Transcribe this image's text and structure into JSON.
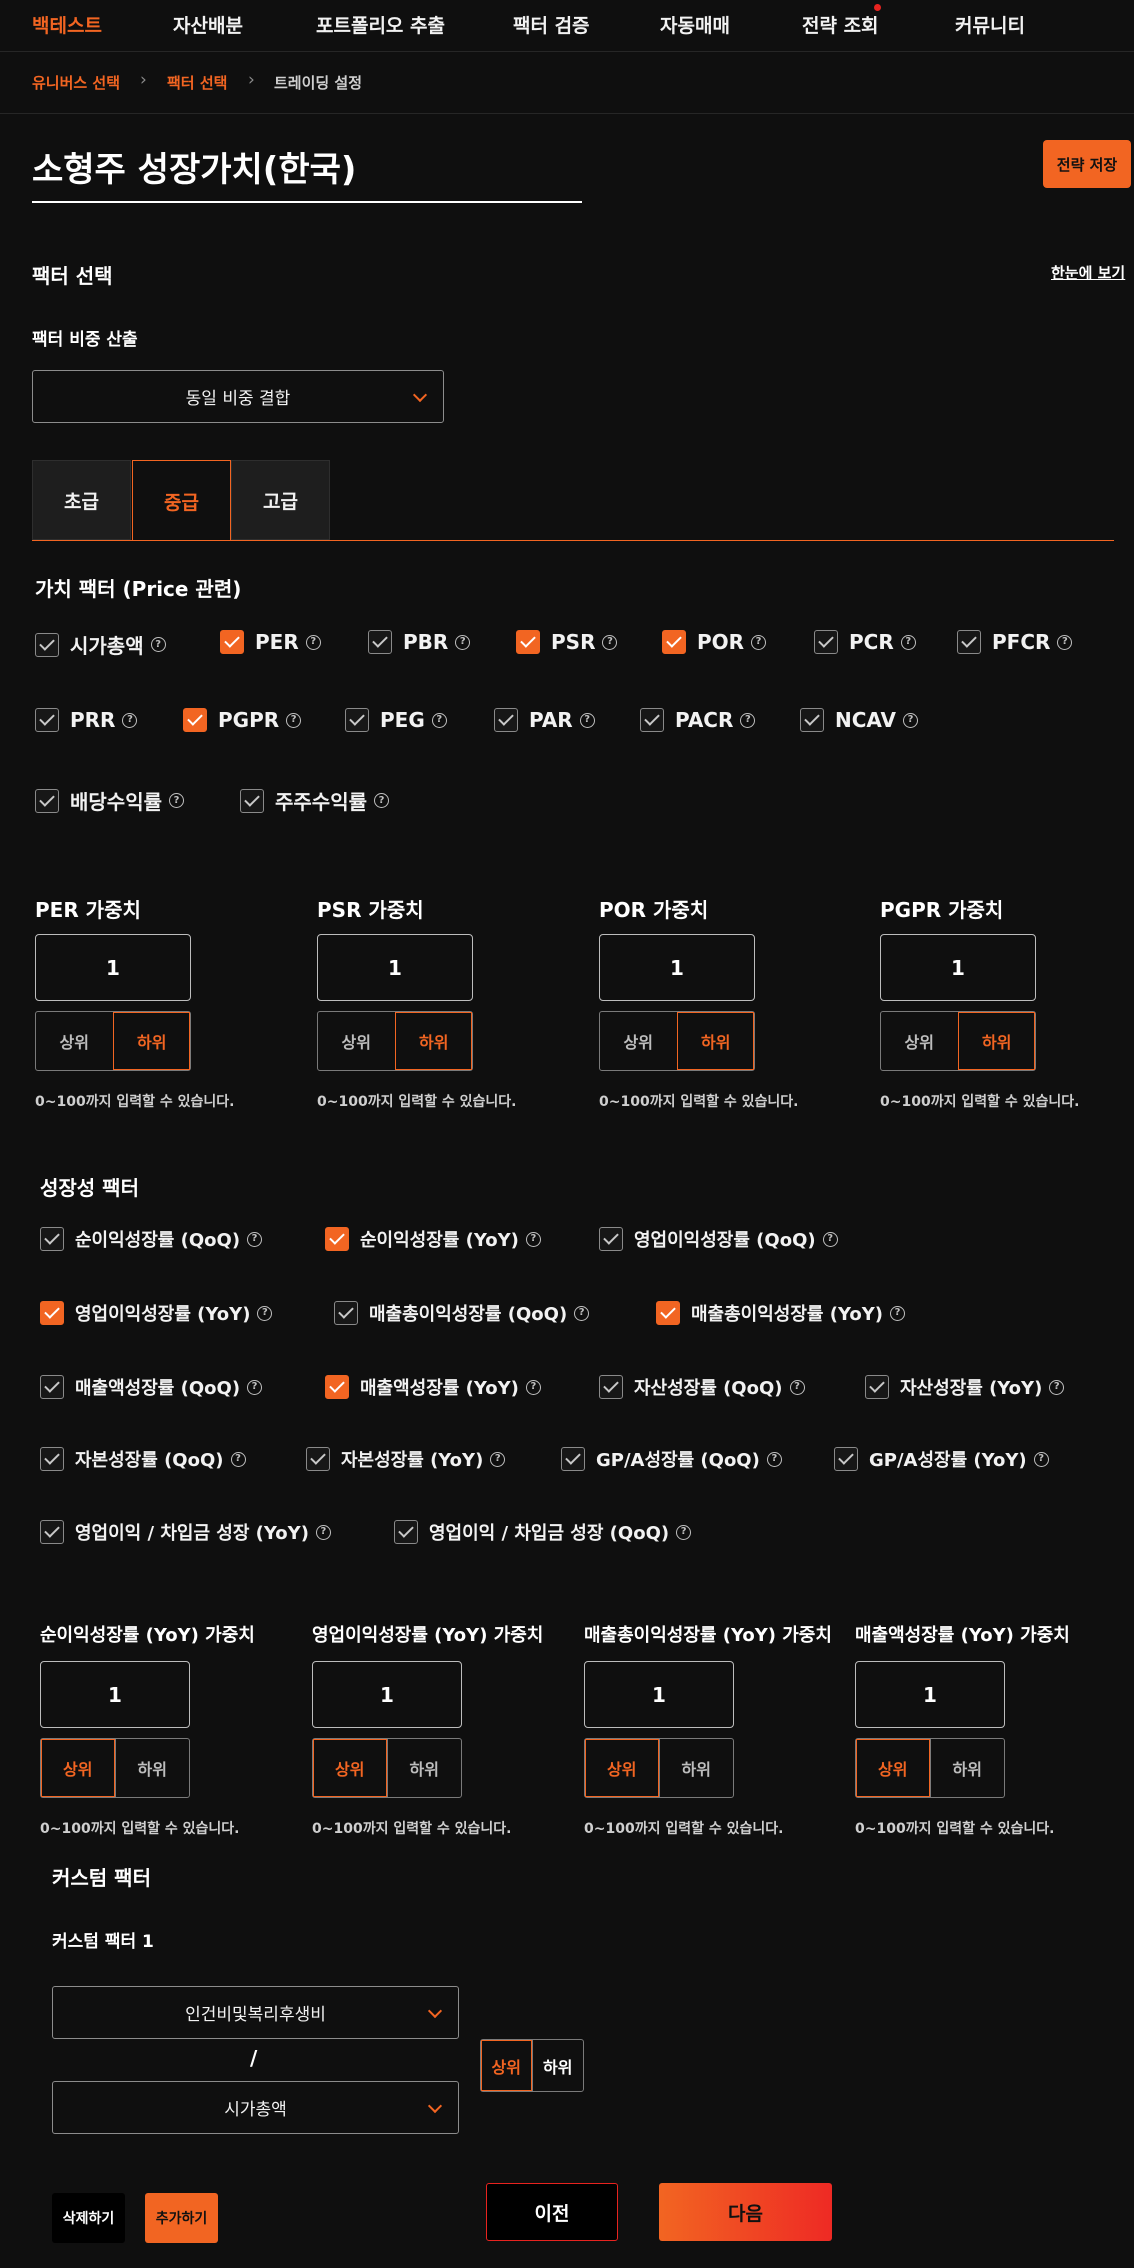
{
  "nav": {
    "items": [
      {
        "label": "백테스트",
        "active": true
      },
      {
        "label": "자산배분"
      },
      {
        "label": "포트폴리오 추출"
      },
      {
        "label": "팩터 검증"
      },
      {
        "label": "자동매매"
      },
      {
        "label": "전략 조회"
      },
      {
        "label": "커뮤니티"
      }
    ]
  },
  "breadcrumb": [
    "유니버스 선택",
    "팩터 선택",
    "트레이딩 설정"
  ],
  "title": "소형주 성장가치(한국)",
  "save_label": "전략 저장",
  "factor_section": {
    "title": "팩터 선택",
    "view_all": "한눈에 보기"
  },
  "weight_method": {
    "label": "팩터 비중 산출",
    "value": "동일 비중 결합"
  },
  "tabs": [
    "초급",
    "중급",
    "고급"
  ],
  "value_factors": {
    "title": "가치 팩터 (Price 관련)",
    "items": [
      {
        "label": "시가총액",
        "checked": false
      },
      {
        "label": "PER",
        "checked": true
      },
      {
        "label": "PBR",
        "checked": false
      },
      {
        "label": "PSR",
        "checked": true
      },
      {
        "label": "POR",
        "checked": true
      },
      {
        "label": "PCR",
        "checked": false
      },
      {
        "label": "PFCR",
        "checked": false
      },
      {
        "label": "PRR",
        "checked": false
      },
      {
        "label": "PGPR",
        "checked": true
      },
      {
        "label": "PEG",
        "checked": false
      },
      {
        "label": "PAR",
        "checked": false
      },
      {
        "label": "PACR",
        "checked": false
      },
      {
        "label": "NCAV",
        "checked": false
      },
      {
        "label": "배당수익률",
        "checked": false
      },
      {
        "label": "주주수익률",
        "checked": false
      }
    ]
  },
  "value_weights": [
    {
      "label": "PER 가중치",
      "value": "1",
      "selected": "하위"
    },
    {
      "label": "PSR 가중치",
      "value": "1",
      "selected": "하위"
    },
    {
      "label": "POR 가중치",
      "value": "1",
      "selected": "하위"
    },
    {
      "label": "PGPR 가중치",
      "value": "1",
      "selected": "하위"
    }
  ],
  "seg_labels": {
    "top": "상위",
    "bottom": "하위"
  },
  "hint": "0~100까지 입력할 수 있습니다.",
  "growth_factors": {
    "title": "성장성 팩터",
    "items": [
      {
        "label": "순이익성장률 (QoQ)",
        "checked": false
      },
      {
        "label": "순이익성장률 (YoY)",
        "checked": true
      },
      {
        "label": "영업이익성장률 (QoQ)",
        "checked": false
      },
      {
        "label": "영업이익성장률 (YoY)",
        "checked": true
      },
      {
        "label": "매출총이익성장률 (QoQ)",
        "checked": false
      },
      {
        "label": "매출총이익성장률 (YoY)",
        "checked": true
      },
      {
        "label": "매출액성장률 (QoQ)",
        "checked": false
      },
      {
        "label": "매출액성장률 (YoY)",
        "checked": true
      },
      {
        "label": "자산성장률 (QoQ)",
        "checked": false
      },
      {
        "label": "자산성장률 (YoY)",
        "checked": false
      },
      {
        "label": "자본성장률 (QoQ)",
        "checked": false
      },
      {
        "label": "자본성장률 (YoY)",
        "checked": false
      },
      {
        "label": "GP/A성장률 (QoQ)",
        "checked": false
      },
      {
        "label": "GP/A성장률 (YoY)",
        "checked": false
      },
      {
        "label": "영업이익 / 차입금 성장 (YoY)",
        "checked": false
      },
      {
        "label": "영업이익 / 차입금 성장 (QoQ)",
        "checked": false
      }
    ]
  },
  "growth_weights": [
    {
      "label": "순이익성장률 (YoY) 가중치",
      "value": "1",
      "selected": "상위"
    },
    {
      "label": "영업이익성장률 (YoY) 가중치",
      "value": "1",
      "selected": "상위"
    },
    {
      "label": "매출총이익성장률 (YoY) 가중치",
      "value": "1",
      "selected": "상위"
    },
    {
      "label": "매출액성장률 (YoY) 가중치",
      "value": "1",
      "selected": "상위"
    }
  ],
  "custom": {
    "title": "커스텀 팩터",
    "factor1_label": "커스텀 팩터 1",
    "numerator": "인건비및복리후생비",
    "divider": "/",
    "denominator": "시가총액",
    "seg_top": "상위",
    "seg_bottom": "하위"
  },
  "buttons": {
    "delete": "삭제하기",
    "add": "추가하기",
    "prev": "이전",
    "next": "다음"
  },
  "colors": {
    "accent": "#f26522",
    "background": "#0f0f0f"
  }
}
